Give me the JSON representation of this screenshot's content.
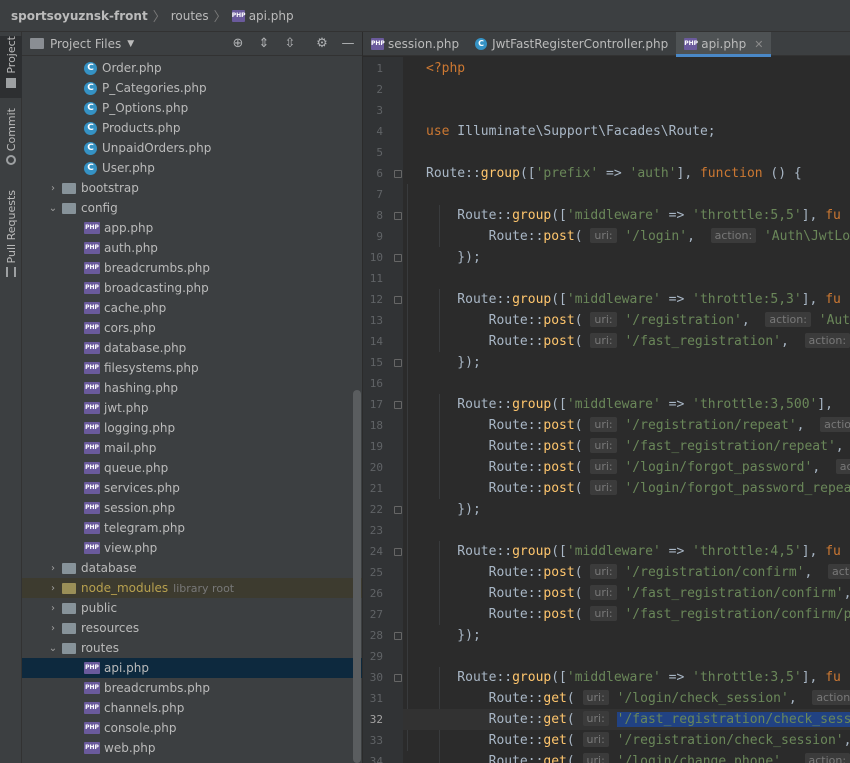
{
  "breadcrumb": [
    "sportsoyuznsk-front",
    "routes",
    "api.php"
  ],
  "toolstrip": {
    "project": "Project",
    "commit": "Commit",
    "pull_requests": "Pull Requests"
  },
  "project_panel": {
    "title": "Project Files"
  },
  "tree": [
    {
      "type": "class",
      "name": "Order.php",
      "indent": 4
    },
    {
      "type": "class",
      "name": "P_Categories.php",
      "indent": 4
    },
    {
      "type": "class",
      "name": "P_Options.php",
      "indent": 4
    },
    {
      "type": "class",
      "name": "Products.php",
      "indent": 4
    },
    {
      "type": "class",
      "name": "UnpaidOrders.php",
      "indent": 4
    },
    {
      "type": "class",
      "name": "User.php",
      "indent": 4
    },
    {
      "type": "dir",
      "name": "bootstrap",
      "indent": 2,
      "expanded": false
    },
    {
      "type": "dir",
      "name": "config",
      "indent": 2,
      "expanded": true
    },
    {
      "type": "php",
      "name": "app.php",
      "indent": 4
    },
    {
      "type": "php",
      "name": "auth.php",
      "indent": 4
    },
    {
      "type": "php",
      "name": "breadcrumbs.php",
      "indent": 4
    },
    {
      "type": "php",
      "name": "broadcasting.php",
      "indent": 4
    },
    {
      "type": "php",
      "name": "cache.php",
      "indent": 4
    },
    {
      "type": "php",
      "name": "cors.php",
      "indent": 4
    },
    {
      "type": "php",
      "name": "database.php",
      "indent": 4
    },
    {
      "type": "php",
      "name": "filesystems.php",
      "indent": 4
    },
    {
      "type": "php",
      "name": "hashing.php",
      "indent": 4
    },
    {
      "type": "php",
      "name": "jwt.php",
      "indent": 4
    },
    {
      "type": "php",
      "name": "logging.php",
      "indent": 4
    },
    {
      "type": "php",
      "name": "mail.php",
      "indent": 4
    },
    {
      "type": "php",
      "name": "queue.php",
      "indent": 4
    },
    {
      "type": "php",
      "name": "services.php",
      "indent": 4
    },
    {
      "type": "php",
      "name": "session.php",
      "indent": 4
    },
    {
      "type": "php",
      "name": "telegram.php",
      "indent": 4
    },
    {
      "type": "php",
      "name": "view.php",
      "indent": 4
    },
    {
      "type": "dir",
      "name": "database",
      "indent": 2,
      "expanded": false
    },
    {
      "type": "dir",
      "name": "node_modules",
      "indent": 2,
      "expanded": false,
      "hint": "library root",
      "library": true
    },
    {
      "type": "dir",
      "name": "public",
      "indent": 2,
      "expanded": false
    },
    {
      "type": "dir",
      "name": "resources",
      "indent": 2,
      "expanded": false
    },
    {
      "type": "dir",
      "name": "routes",
      "indent": 2,
      "expanded": true
    },
    {
      "type": "php",
      "name": "api.php",
      "indent": 4,
      "selected": true
    },
    {
      "type": "php",
      "name": "breadcrumbs.php",
      "indent": 4
    },
    {
      "type": "php",
      "name": "channels.php",
      "indent": 4
    },
    {
      "type": "php",
      "name": "console.php",
      "indent": 4
    },
    {
      "type": "php",
      "name": "web.php",
      "indent": 4
    }
  ],
  "tabs": [
    {
      "label": "session.php",
      "icon": "php",
      "active": false
    },
    {
      "label": "JwtFastRegisterController.php",
      "icon": "class",
      "active": false
    },
    {
      "label": "api.php",
      "icon": "php",
      "active": true
    }
  ],
  "current_line": 32,
  "code_lines": [
    {
      "n": 1,
      "html": "<span class='tag'>&lt;?php</span>"
    },
    {
      "n": 2,
      "html": ""
    },
    {
      "n": 3,
      "html": ""
    },
    {
      "n": 4,
      "html": "<span class='kw'>use</span> Illuminate\\Support\\Facades\\Route;"
    },
    {
      "n": 5,
      "html": ""
    },
    {
      "n": 6,
      "html": "Route::<span class='fn'>group</span>([<span class='str'>'prefix'</span> =&gt; <span class='str'>'auth'</span>], <span class='kw'>function</span> () {"
    },
    {
      "n": 7,
      "html": ""
    },
    {
      "n": 8,
      "html": "    Route::<span class='fn'>group</span>([<span class='str'>'middleware'</span> =&gt; <span class='str'>'throttle:5,5'</span>], <span class='kw'>fu</span>"
    },
    {
      "n": 9,
      "html": "        Route::<span class='fn'>post</span>( <span class='ph'>uri:</span> <span class='str'>'/login'</span>,  <span class='ph'>action:</span> <span class='str'>'Auth\\JwtLogi</span>"
    },
    {
      "n": 10,
      "html": "    });"
    },
    {
      "n": 11,
      "html": ""
    },
    {
      "n": 12,
      "html": "    Route::<span class='fn'>group</span>([<span class='str'>'middleware'</span> =&gt; <span class='str'>'throttle:5,3'</span>], <span class='kw'>fu</span>"
    },
    {
      "n": 13,
      "html": "        Route::<span class='fn'>post</span>( <span class='ph'>uri:</span> <span class='str'>'/registration'</span>,  <span class='ph'>action:</span> <span class='str'>'Auth\\</span>"
    },
    {
      "n": 14,
      "html": "        Route::<span class='fn'>post</span>( <span class='ph'>uri:</span> <span class='str'>'/fast_registration'</span>,  <span class='ph'>action:</span> <span class='str'>'</span>"
    },
    {
      "n": 15,
      "html": "    });"
    },
    {
      "n": 16,
      "html": ""
    },
    {
      "n": 17,
      "html": "    Route::<span class='fn'>group</span>([<span class='str'>'middleware'</span> =&gt; <span class='str'>'throttle:3,500'</span>],"
    },
    {
      "n": 18,
      "html": "        Route::<span class='fn'>post</span>( <span class='ph'>uri:</span> <span class='str'>'/registration/repeat'</span>,  <span class='ph'>actio</span>"
    },
    {
      "n": 19,
      "html": "        Route::<span class='fn'>post</span>( <span class='ph'>uri:</span> <span class='str'>'/fast_registration/repeat'</span>,"
    },
    {
      "n": 20,
      "html": "        Route::<span class='fn'>post</span>( <span class='ph'>uri:</span> <span class='str'>'/login/forgot_password'</span>,  <span class='ph'>act</span>"
    },
    {
      "n": 21,
      "html": "        Route::<span class='fn'>post</span>( <span class='ph'>uri:</span> <span class='str'>'/login/forgot_password_repea</span>"
    },
    {
      "n": 22,
      "html": "    });"
    },
    {
      "n": 23,
      "html": ""
    },
    {
      "n": 24,
      "html": "    Route::<span class='fn'>group</span>([<span class='str'>'middleware'</span> =&gt; <span class='str'>'throttle:4,5'</span>], <span class='kw'>fu</span>"
    },
    {
      "n": 25,
      "html": "        Route::<span class='fn'>post</span>( <span class='ph'>uri:</span> <span class='str'>'/registration/confirm'</span>,  <span class='ph'>actio</span>"
    },
    {
      "n": 26,
      "html": "        Route::<span class='fn'>post</span>( <span class='ph'>uri:</span> <span class='str'>'/fast_registration/confirm'</span>,"
    },
    {
      "n": 27,
      "html": "        Route::<span class='fn'>post</span>( <span class='ph'>uri:</span> <span class='str'>'/fast_registration/confirm/p</span>"
    },
    {
      "n": 28,
      "html": "    });"
    },
    {
      "n": 29,
      "html": ""
    },
    {
      "n": 30,
      "html": "    Route::<span class='fn'>group</span>([<span class='str'>'middleware'</span> =&gt; <span class='str'>'throttle:3,5'</span>], <span class='kw'>fu</span>"
    },
    {
      "n": 31,
      "html": "        Route::<span class='fn'>get</span>( <span class='ph'>uri:</span> <span class='str'>'/login/check_session'</span>,  <span class='ph'>action:</span>"
    },
    {
      "n": 32,
      "html": "        Route::<span class='fn'>get</span>( <span class='ph'>uri:</span> <span class='str sel'>'/fast_registration/check_sess</span>"
    },
    {
      "n": 33,
      "html": "        Route::<span class='fn'>get</span>( <span class='ph'>uri:</span> <span class='str'>'/registration/check_session'</span>,"
    },
    {
      "n": 34,
      "html": "        Route::<span class='fn'>get</span>( <span class='ph'>uri:</span> <span class='str'>'/login/change_phone'</span>,  <span class='ph'>action:</span>"
    }
  ],
  "colors": {
    "accent": "#4a88c7",
    "selection": "#0d293e",
    "keyword": "#cc7832",
    "string": "#6a8759",
    "function": "#ffc66d"
  }
}
